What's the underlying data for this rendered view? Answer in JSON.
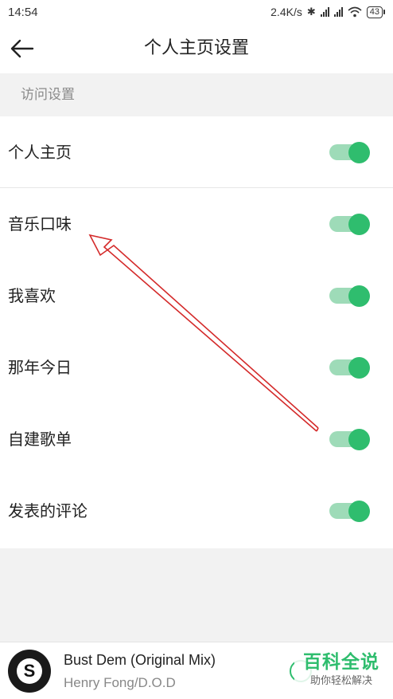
{
  "status_bar": {
    "time": "14:54",
    "network_speed": "2.4K/s",
    "battery_level": "43"
  },
  "nav": {
    "title": "个人主页设置"
  },
  "section": {
    "title": "访问设置"
  },
  "settings": [
    {
      "label": "个人主页",
      "enabled": true
    },
    {
      "label": "音乐口味",
      "enabled": true
    },
    {
      "label": "我喜欢",
      "enabled": true
    },
    {
      "label": "那年今日",
      "enabled": true
    },
    {
      "label": "自建歌单",
      "enabled": true
    },
    {
      "label": "发表的评论",
      "enabled": true
    }
  ],
  "player": {
    "song_title": "Bust Dem (Original Mix)",
    "artist": "Henry Fong/D.O.D",
    "album_letter": "S"
  },
  "watermark": {
    "main": "百科全说",
    "sub": "助你轻松解决"
  },
  "colors": {
    "accent": "#2fbd6e",
    "toggle_track": "#9edbb8",
    "annotation_arrow": "#d42a2a",
    "page_bg": "#f2f2f2"
  }
}
